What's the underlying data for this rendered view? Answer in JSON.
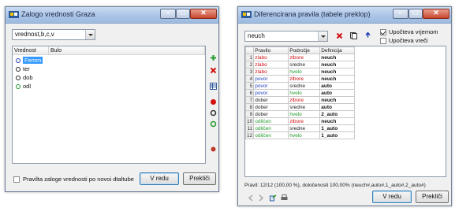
{
  "window_left": {
    "title": "Zalogo vrednosti Graza",
    "combo_value": "vrednost,b,c,v",
    "columns": [
      "Vrednost",
      "Bulo"
    ],
    "items": [
      {
        "label": "Femm",
        "color": "#1f3fb8",
        "selected": true
      },
      {
        "label": "ter",
        "color": "#222222",
        "selected": false
      },
      {
        "label": "dob",
        "color": "#222222",
        "selected": false
      },
      {
        "label": "odl",
        "color": "#1f9a2a",
        "selected": false
      }
    ],
    "checkbox_label": "Pravilta zaloge vrednosti po novoi dtaltube",
    "ok_label": "V redu",
    "cancel_label": "Prekliči"
  },
  "window_right": {
    "title": "Diferencirana pravila (tabele preklop)",
    "combo_value": "neuch",
    "check1_label": "Upočteva vrjemom",
    "check2_label": "Upočteva vreči",
    "columns": [
      "Pravilo",
      "Področje",
      "Definicija"
    ],
    "rows": [
      {
        "n": "1",
        "a": "zlabo",
        "b": "zlbore",
        "c": "neuch",
        "ca": "red",
        "cb": "red"
      },
      {
        "n": "2",
        "a": "zlabo",
        "b": "sredne",
        "c": "neuch",
        "ca": "red",
        "cb": "dark"
      },
      {
        "n": "3",
        "a": "zlabo",
        "b": "hvelo",
        "c": "neuch",
        "ca": "red",
        "cb": "green"
      },
      {
        "n": "4",
        "a": "povor",
        "b": "zlbore",
        "c": "neuch",
        "ca": "blue",
        "cb": "red"
      },
      {
        "n": "5",
        "a": "povor",
        "b": "sredne",
        "c": "auto",
        "ca": "blue",
        "cb": "dark"
      },
      {
        "n": "6",
        "a": "povor",
        "b": "hvelo",
        "c": "auto",
        "ca": "blue",
        "cb": "green"
      },
      {
        "n": "7",
        "a": "dober",
        "b": "zlbore",
        "c": "neuch",
        "ca": "dark",
        "cb": "red"
      },
      {
        "n": "8",
        "a": "dober",
        "b": "sredne",
        "c": "auto",
        "ca": "dark",
        "cb": "dark"
      },
      {
        "n": "9",
        "a": "dober",
        "b": "hvelo",
        "c": "2_auto",
        "ca": "dark",
        "cb": "green"
      },
      {
        "n": "10",
        "a": "odličen",
        "b": "zlbore",
        "c": "neuch",
        "ca": "green",
        "cb": "red"
      },
      {
        "n": "11",
        "a": "odličen",
        "b": "sredne",
        "c": "1_auto",
        "ca": "green",
        "cb": "dark"
      },
      {
        "n": "12",
        "a": "odličen",
        "b": "hvelo",
        "c": "1_auto",
        "ca": "green",
        "cb": "green"
      }
    ],
    "status": "Pravil: 12/12 (100,00 %), določenosti 100,00% (neuch#,auto#,1_auto#,2_auto#)",
    "ok_label": "V redu",
    "cancel_label": "Prekliči"
  },
  "colors": {
    "red": "#d01010",
    "blue": "#1f3fb8",
    "green": "#1f9a2a",
    "dark": "#222222",
    "selection": "#3399ff"
  }
}
